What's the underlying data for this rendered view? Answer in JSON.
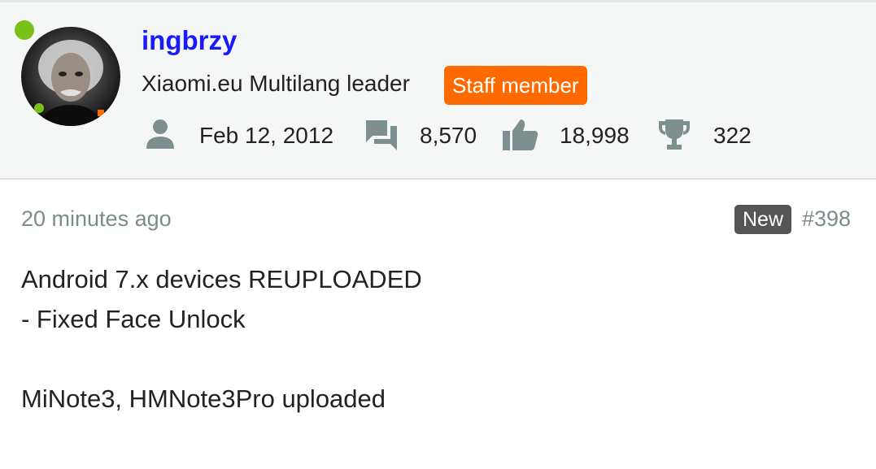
{
  "user": {
    "username": "ingbrzy",
    "title": "Xiaomi.eu Multilang leader",
    "badge": "Staff member",
    "online_color": "#7ac21a",
    "stats": [
      {
        "icon": "user-icon",
        "value": "Feb 12, 2012"
      },
      {
        "icon": "messages-icon",
        "value": "8,570"
      },
      {
        "icon": "thumbs-up-icon",
        "value": "18,998"
      },
      {
        "icon": "trophy-icon",
        "value": "322"
      }
    ]
  },
  "post": {
    "time": "20 minutes ago",
    "new_label": "New",
    "number": "#398",
    "lines": [
      "Android 7.x devices REUPLOADED",
      "- Fixed Face Unlock",
      "",
      "MiNote3, HMNote3Pro uploaded"
    ]
  },
  "colors": {
    "username": "#1a1aff",
    "staff_badge": "#ff6a00",
    "new_badge": "#555555",
    "muted_text": "#7c8c8c",
    "icon": "#7d8f8f"
  }
}
